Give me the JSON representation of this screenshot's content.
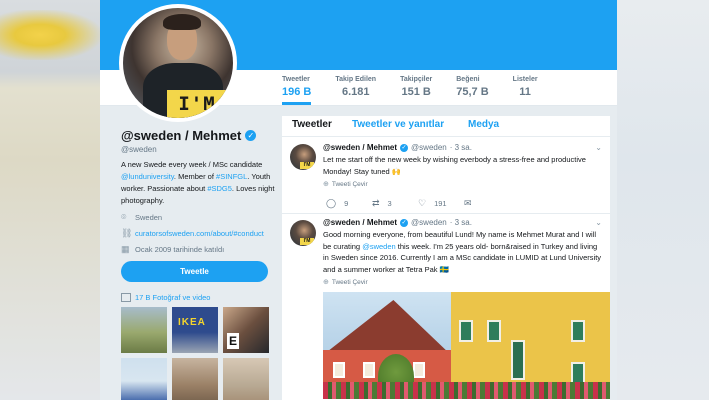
{
  "profile": {
    "display_name": "@sweden / Mehmet",
    "handle": "@sweden",
    "avatar_badge": "I'M",
    "bio_prefix": "A new Swede every week / MSc candidate ",
    "bio_link1": "@lunduniversity",
    "bio_mid1": ". Member of ",
    "bio_link2": "#SINFGL",
    "bio_mid2": ". Youth worker. Passionate about ",
    "bio_link3": "#SDG5",
    "bio_suffix": ". Loves night photography.",
    "location": "Sweden",
    "website": "curatorsofsweden.com/about/#conduct",
    "joined": "Ocak 2009 tarihinde katıldı",
    "tweet_button": "Tweetle",
    "photos_label": "17 B Fotoğraf ve video"
  },
  "stats": [
    {
      "label": "Tweetler",
      "value": "196 B",
      "active": true
    },
    {
      "label": "Takip Edilen",
      "value": "6.181"
    },
    {
      "label": "Takipçiler",
      "value": "151 B"
    },
    {
      "label": "Beğeni",
      "value": "75,7 B"
    },
    {
      "label": "Listeler",
      "value": "11"
    }
  ],
  "tabs": [
    {
      "label": "Tweetler",
      "active": true
    },
    {
      "label": "Tweetler ve yanıtlar"
    },
    {
      "label": "Medya"
    }
  ],
  "tweets": [
    {
      "name": "@sweden / Mehmet",
      "handle": "@sweden",
      "time": "· 3 sa.",
      "text": "Let me start off the new week by wishing everbody a stress-free and productive Monday! Stay tuned 🙌",
      "translate": "Tweeti Çevir",
      "replies": "9",
      "retweets": "3",
      "likes": "191"
    },
    {
      "name": "@sweden / Mehmet",
      "handle": "@sweden",
      "time": "· 3 sa.",
      "text_prefix": "Good morning everyone, from beautiful Lund! My name is Mehmet Murat and I will be curating ",
      "text_link": "@sweden",
      "text_suffix": " this week. I'm 25 years old- born&raised in Turkey and living in Sweden since 2016. Currently I am a MSc candidate in LUMID at Lund University and a summer worker at Tetra Pak 🇸🇪",
      "translate": "Tweeti Çevir"
    }
  ],
  "colors": {
    "accent": "#1da1f2",
    "background": "#e6ecf0",
    "badge_yellow": "#f3d64a"
  }
}
